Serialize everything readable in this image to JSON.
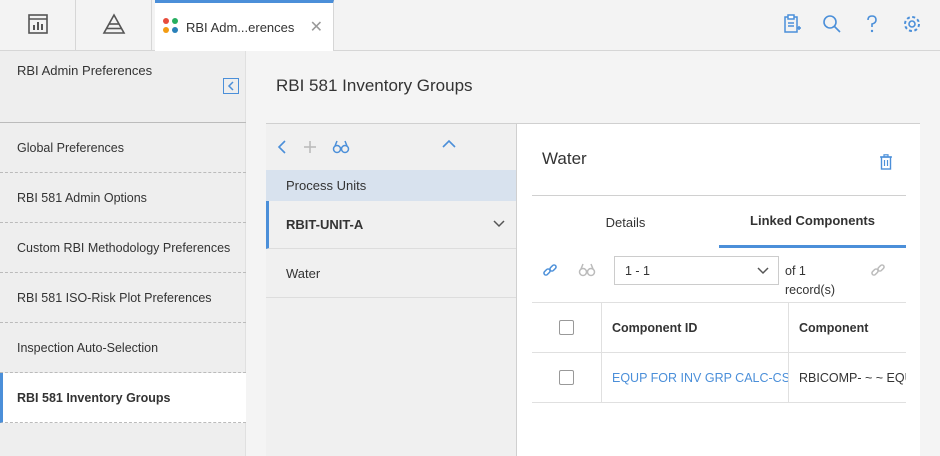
{
  "topbar": {
    "tab_label": "RBI Adm...erences",
    "tab_close": "✕",
    "icons": [
      "dashboard-icon",
      "pyramid-icon",
      "clipboard-add-icon",
      "search-icon",
      "help-icon",
      "settings-icon"
    ]
  },
  "sidebar": {
    "title": "RBI Admin Preferences",
    "items": [
      {
        "label": "Global Preferences"
      },
      {
        "label": "RBI 581 Admin Options"
      },
      {
        "label": "Custom RBI Methodology Preferences"
      },
      {
        "label": "RBI 581 ISO-Risk Plot Preferences"
      },
      {
        "label": "Inspection Auto-Selection"
      },
      {
        "label": "RBI 581 Inventory Groups"
      }
    ]
  },
  "main": {
    "title": "RBI 581 Inventory Groups"
  },
  "tree": {
    "header": "Process Units",
    "node": "RBIT-UNIT-A",
    "leaf": "Water"
  },
  "detail": {
    "title": "Water",
    "tabs": [
      {
        "label": "Details"
      },
      {
        "label": "Linked Components"
      }
    ],
    "pager_value": "1 - 1",
    "of_text": "of 1",
    "records_text": "record(s)",
    "columns": [
      "Component ID",
      "Component"
    ],
    "rows": [
      {
        "component_id": "EQUP FOR INV GRP CALC-CS ~",
        "component": "RBICOMP- ~ ~ EQUIP"
      }
    ]
  },
  "colors": {
    "accent": "#4b8fd9",
    "tree_header": "#d8e2ee"
  }
}
